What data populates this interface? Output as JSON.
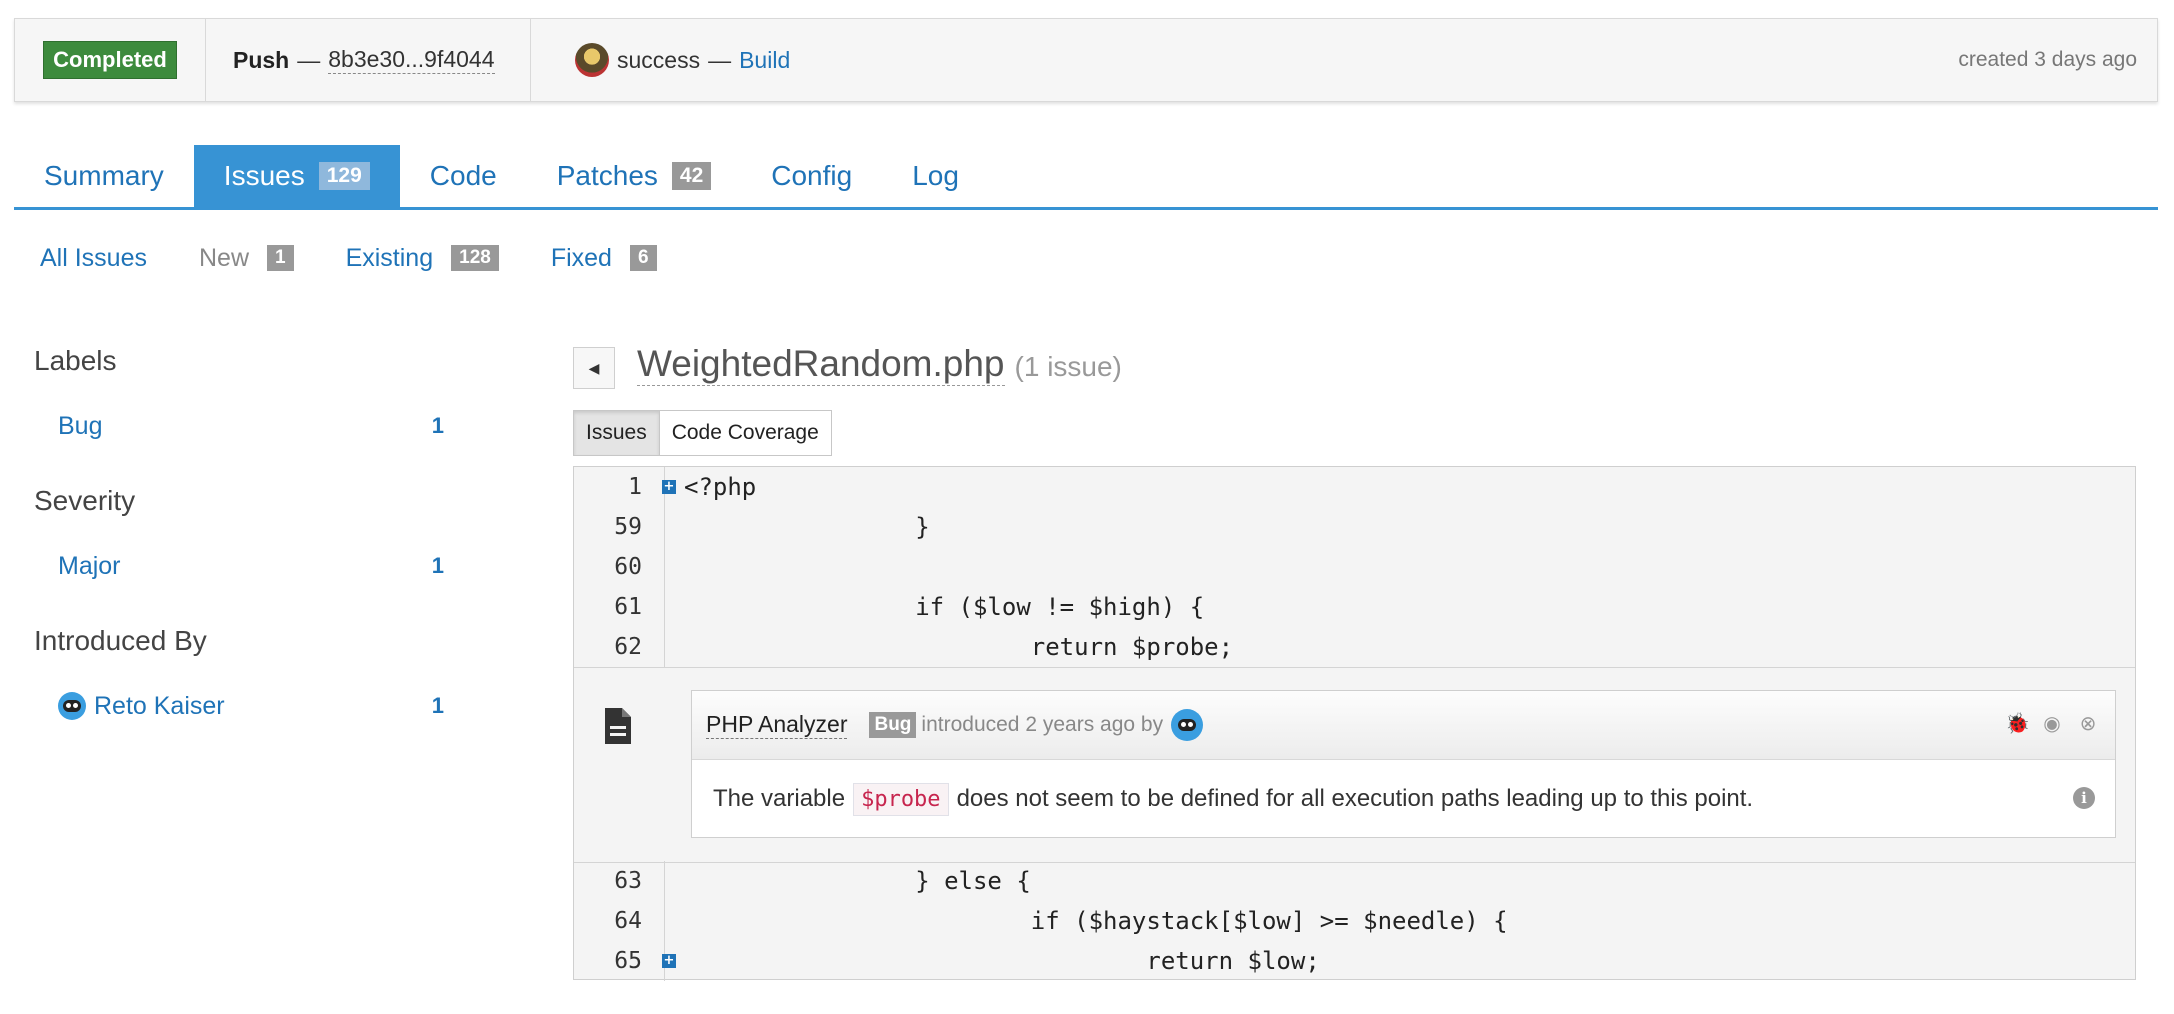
{
  "topbar": {
    "status": "Completed",
    "push_label": "Push",
    "commit_range": "8b3e30...9f4044",
    "build_status": "success",
    "build_link": "Build",
    "created": "created 3 days ago",
    "dash": "—"
  },
  "tabs": [
    {
      "label": "Summary",
      "count": null
    },
    {
      "label": "Issues",
      "count": "129",
      "active": true
    },
    {
      "label": "Code",
      "count": null
    },
    {
      "label": "Patches",
      "count": "42"
    },
    {
      "label": "Config",
      "count": null
    },
    {
      "label": "Log",
      "count": null
    }
  ],
  "subtabs": [
    {
      "label": "All Issues",
      "count": null
    },
    {
      "label": "New",
      "count": "1"
    },
    {
      "label": "Existing",
      "count": "128"
    },
    {
      "label": "Fixed",
      "count": "6"
    }
  ],
  "sidebar": {
    "labels_heading": "Labels",
    "labels": [
      {
        "label": "Bug",
        "count": "1"
      }
    ],
    "severity_heading": "Severity",
    "severity": [
      {
        "label": "Major",
        "count": "1"
      }
    ],
    "introduced_heading": "Introduced By",
    "introduced": [
      {
        "label": "Reto Kaiser",
        "count": "1"
      }
    ]
  },
  "file": {
    "name": "WeightedRandom.php",
    "issue_count": "(1 issue)",
    "view_issues": "Issues",
    "view_coverage": "Code Coverage"
  },
  "code": {
    "lines_before": [
      {
        "num": "1",
        "text": "<?php"
      },
      {
        "num": "59",
        "text": "                }"
      },
      {
        "num": "60",
        "text": ""
      },
      {
        "num": "61",
        "text": "                if ($low != $high) {"
      },
      {
        "num": "62",
        "text": "                        return $probe;"
      }
    ],
    "lines_after": [
      {
        "num": "63",
        "text": "                } else {"
      },
      {
        "num": "64",
        "text": "                        if ($haystack[$low] >= $needle) {"
      },
      {
        "num": "65",
        "text": "                                return $low;"
      }
    ]
  },
  "comment": {
    "analyzer": "PHP Analyzer",
    "label": "Bug",
    "introduced": "introduced 2 years ago by",
    "message_before": "The variable",
    "variable": "$probe",
    "message_after": "does not seem to be defined for all execution paths leading up to this point."
  },
  "colors": {
    "accent": "#3793d4",
    "link": "#1f73b7",
    "success": "#3d8b3d"
  }
}
